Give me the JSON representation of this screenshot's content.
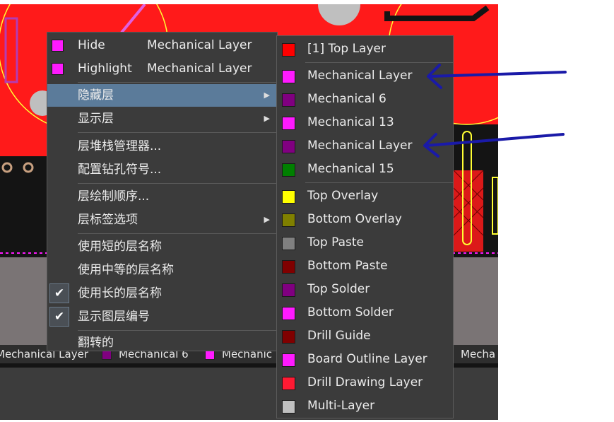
{
  "context_menu": {
    "items": [
      {
        "label": "Hide",
        "sub": "Mechanical Layer",
        "swatch": "#ff1aff"
      },
      {
        "label": "Highlight",
        "sub": "Mechanical Layer",
        "swatch": "#ff1aff"
      },
      {
        "label": "隐藏层",
        "has_submenu": true,
        "active": true
      },
      {
        "label": "显示层",
        "has_submenu": true
      },
      {
        "label": "层堆栈管理器..."
      },
      {
        "label": "配置钻孔符号..."
      },
      {
        "label": "层绘制顺序..."
      },
      {
        "label": "层标签选项",
        "has_submenu": true
      },
      {
        "label": "使用短的层名称"
      },
      {
        "label": "使用中等的层名称"
      },
      {
        "label": "使用长的层名称",
        "checked": true
      },
      {
        "label": "显示图层编号",
        "checked": true
      },
      {
        "label": "翻转的"
      }
    ]
  },
  "submenu": {
    "items": [
      {
        "label": "[1] Top Layer",
        "color": "#ff0000"
      },
      {
        "label": "Mechanical Layer",
        "color": "#ff1aff"
      },
      {
        "label": "Mechanical 6",
        "color": "#800080"
      },
      {
        "label": "Mechanical 13",
        "color": "#ff1aff"
      },
      {
        "label": "Mechanical Layer",
        "color": "#800080"
      },
      {
        "label": "Mechanical 15",
        "color": "#008000"
      },
      {
        "label": "Top Overlay",
        "color": "#ffff00"
      },
      {
        "label": "Bottom Overlay",
        "color": "#808000"
      },
      {
        "label": "Top Paste",
        "color": "#808080"
      },
      {
        "label": "Bottom Paste",
        "color": "#800000"
      },
      {
        "label": "Top Solder",
        "color": "#800080"
      },
      {
        "label": "Bottom Solder",
        "color": "#ff1aff"
      },
      {
        "label": "Drill Guide",
        "color": "#800000"
      },
      {
        "label": "Board Outline Layer",
        "color": "#ff1aff"
      },
      {
        "label": "Drill Drawing Layer",
        "color": "#ff1a33"
      },
      {
        "label": "Multi-Layer",
        "color": "#c0c0c0"
      }
    ]
  },
  "layer_tabs": [
    {
      "label": "Mechanical Layer",
      "color": "#ff1aff"
    },
    {
      "label": "Mechanical 6",
      "color": "#800080"
    },
    {
      "label": "Mechanic",
      "color": "#ff1aff"
    },
    {
      "label": "Mecha",
      "color": "#ff1aff"
    }
  ],
  "colors": {
    "menu_bg": "#3b3b3b",
    "menu_highlight": "#5b7b9a",
    "annotation_arrow": "#1a1aa8",
    "pcb_copper": "#ff1a1a",
    "pcb_background": "#141414"
  }
}
